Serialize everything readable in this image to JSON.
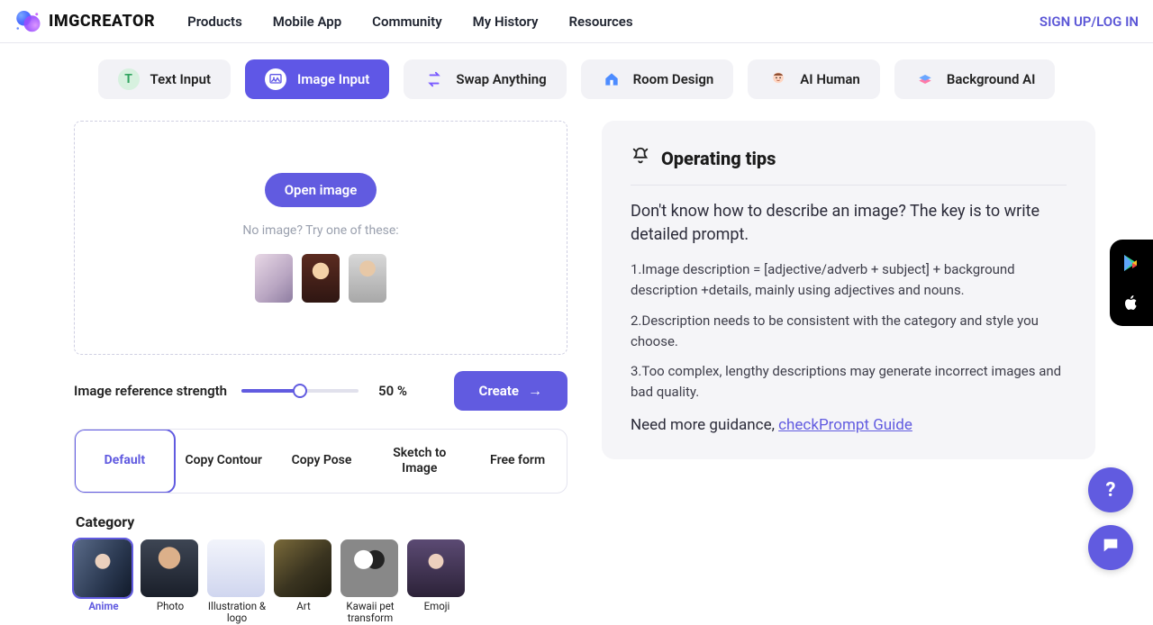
{
  "brand": "IMGCREATOR",
  "nav": {
    "products": "Products",
    "mobile": "Mobile App",
    "community": "Community",
    "history": "My History",
    "resources": "Resources"
  },
  "auth": "SIGN UP/LOG IN",
  "modes": {
    "text": "Text Input",
    "image": "Image Input",
    "swap": "Swap Anything",
    "room": "Room Design",
    "human": "AI Human",
    "bg": "Background AI"
  },
  "upload": {
    "open": "Open image",
    "no_image": "No image? Try one of these:"
  },
  "strength": {
    "label": "Image reference strength",
    "value": "50 %"
  },
  "create": "Create",
  "style_tabs": {
    "default": "Default",
    "contour": "Copy Contour",
    "pose": "Copy Pose",
    "sketch": "Sketch to Image",
    "free": "Free form"
  },
  "category": {
    "title": "Category",
    "items": [
      "Anime",
      "Photo",
      "Illustration & logo",
      "Art",
      "Kawaii pet transform",
      "Emoji"
    ]
  },
  "tips": {
    "head": "Operating tips",
    "lead": "Don't know how to describe an image? The key is to write detailed prompt.",
    "p1": "1.Image description = [adjective/adverb + subject] + background description +details, mainly using adjectives and nouns.",
    "p2": "2.Description needs to be consistent with the category and style you choose.",
    "p3": "3.Too complex, lengthy descriptions may generate incorrect images and bad quality.",
    "more_prefix": "Need more guidance, ",
    "more_link": "checkPrompt Guide"
  }
}
